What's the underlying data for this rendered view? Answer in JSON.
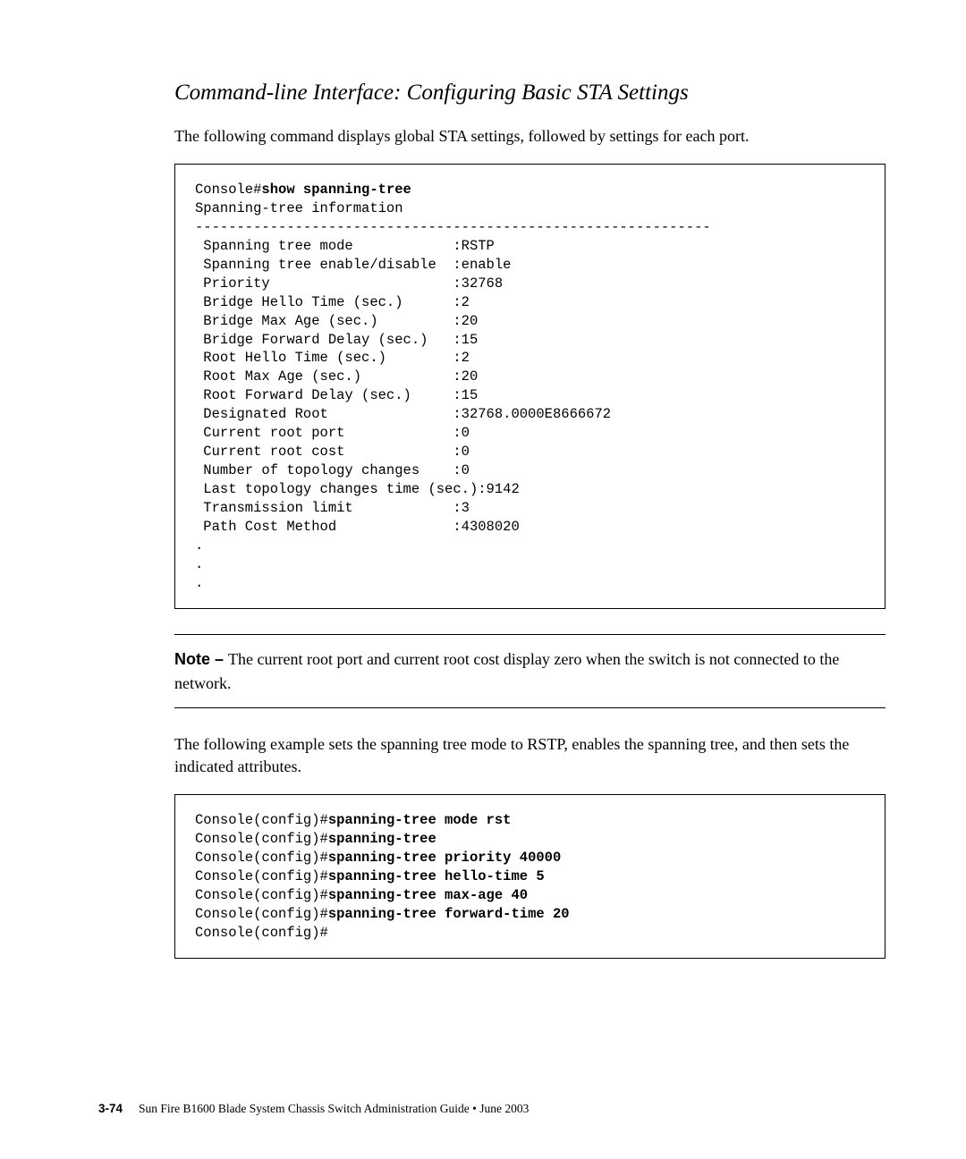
{
  "section_title": "Command-line Interface: Configuring Basic STA Settings",
  "intro_text": "The following command displays global STA settings, followed by settings for each port.",
  "code1": {
    "prompt": "Console#",
    "cmd": "show spanning-tree",
    "info_header": "Spanning-tree information",
    "divider": "--------------------------------------------------------------",
    "rows": [
      {
        "label": " Spanning tree mode            ",
        "value": ":RSTP"
      },
      {
        "label": " Spanning tree enable/disable  ",
        "value": ":enable"
      },
      {
        "label": " Priority                      ",
        "value": ":32768"
      },
      {
        "label": " Bridge Hello Time (sec.)      ",
        "value": ":2"
      },
      {
        "label": " Bridge Max Age (sec.)         ",
        "value": ":20"
      },
      {
        "label": " Bridge Forward Delay (sec.)   ",
        "value": ":15"
      },
      {
        "label": " Root Hello Time (sec.)        ",
        "value": ":2"
      },
      {
        "label": " Root Max Age (sec.)           ",
        "value": ":20"
      },
      {
        "label": " Root Forward Delay (sec.)     ",
        "value": ":15"
      },
      {
        "label": " Designated Root               ",
        "value": ":32768.0000E8666672"
      },
      {
        "label": " Current root port             ",
        "value": ":0"
      },
      {
        "label": " Current root cost             ",
        "value": ":0"
      },
      {
        "label": " Number of topology changes    ",
        "value": ":0"
      },
      {
        "label": " Last topology changes time (sec.)",
        "value": ":9142"
      },
      {
        "label": " Transmission limit            ",
        "value": ":3"
      },
      {
        "label": " Path Cost Method              ",
        "value": ":4308020"
      }
    ],
    "ellipsis": ".\n.\n."
  },
  "note": {
    "label": "Note – ",
    "text": "The current root port and current root cost display zero when the switch is not connected to the network."
  },
  "mid_text": "The following example sets the spanning tree mode to RSTP, enables the spanning tree, and then sets the indicated attributes.",
  "code2": {
    "lines": [
      {
        "prompt": "Console(config)#",
        "cmd": "spanning-tree mode rst"
      },
      {
        "prompt": "Console(config)#",
        "cmd": "spanning-tree"
      },
      {
        "prompt": "Console(config)#",
        "cmd": "spanning-tree priority 40000"
      },
      {
        "prompt": "Console(config)#",
        "cmd": "spanning-tree hello-time 5"
      },
      {
        "prompt": "Console(config)#",
        "cmd": "spanning-tree max-age 40"
      },
      {
        "prompt": "Console(config)#",
        "cmd": "spanning-tree forward-time 20"
      },
      {
        "prompt": "Console(config)#",
        "cmd": ""
      }
    ]
  },
  "footer": {
    "page": "3-74",
    "title": "Sun Fire B1600 Blade System Chassis Switch Administration Guide • June 2003"
  }
}
